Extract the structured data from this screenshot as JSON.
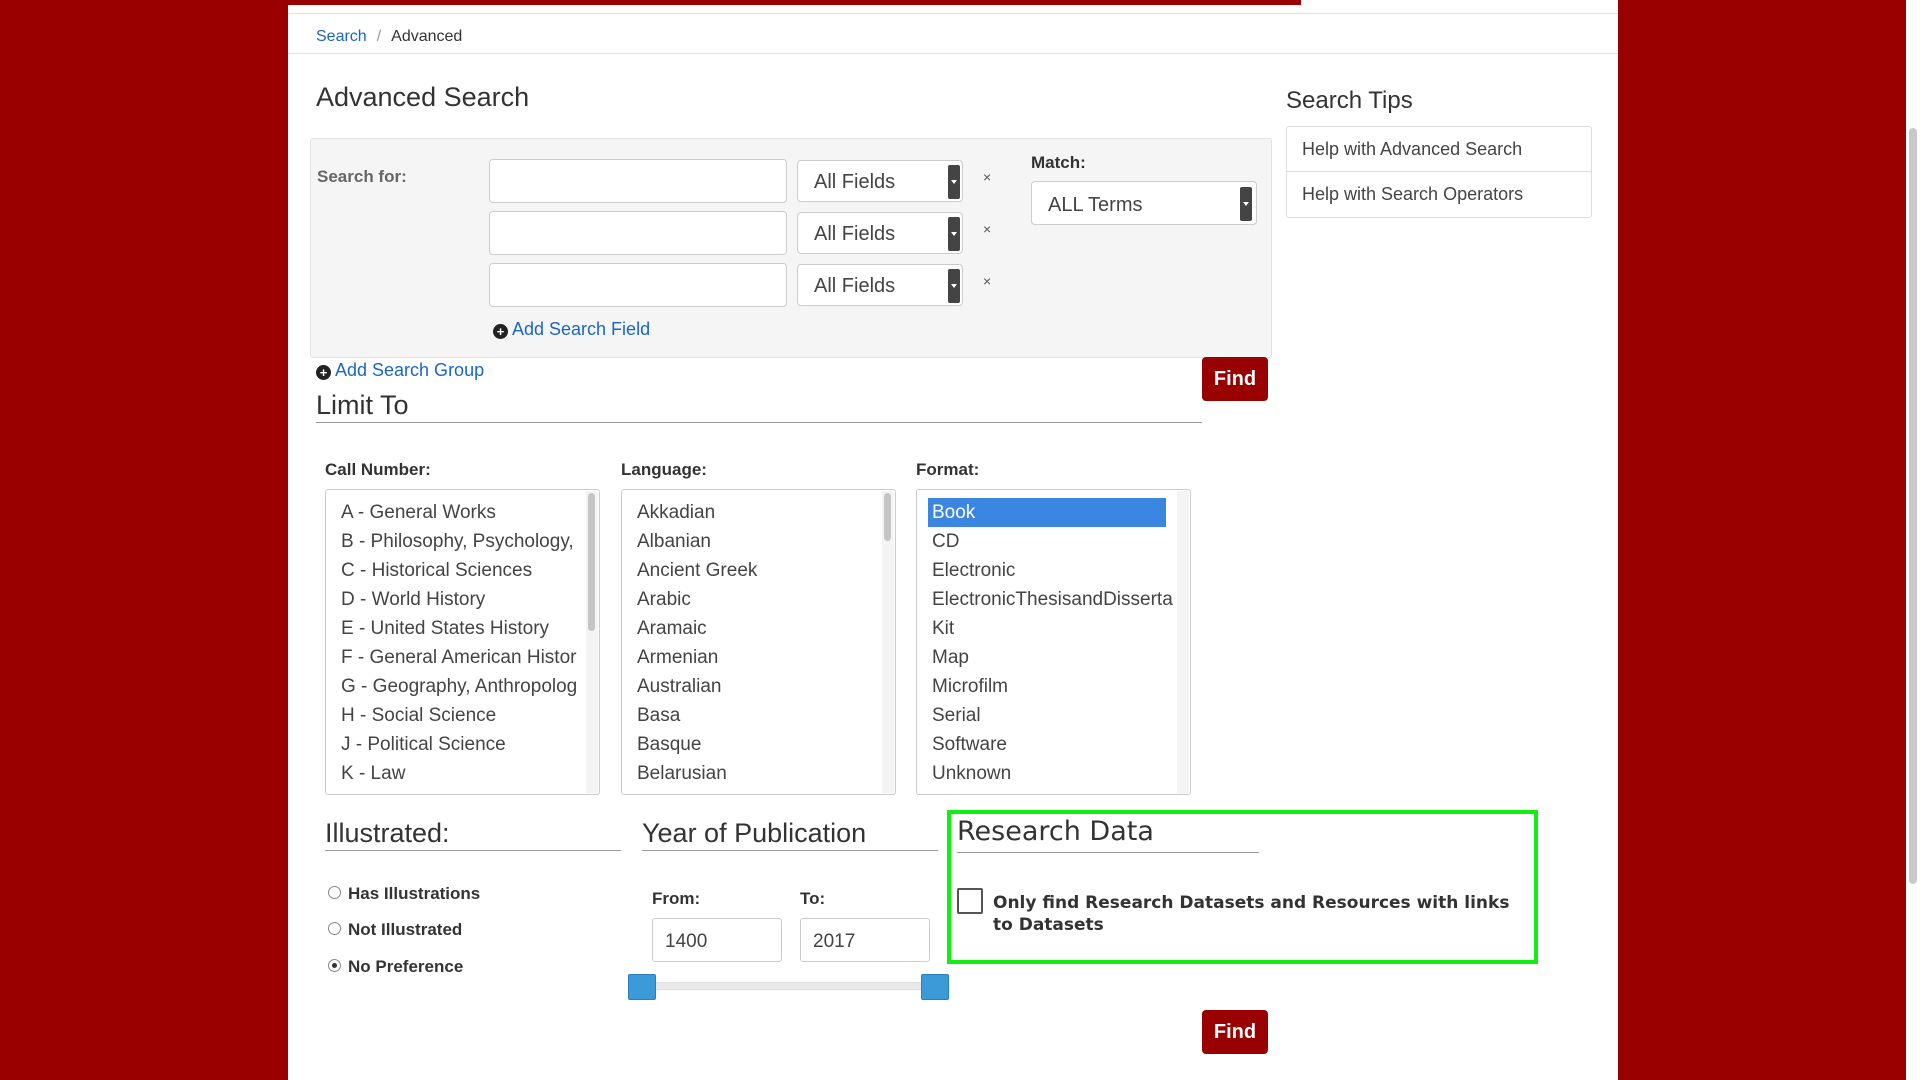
{
  "breadcrumb": {
    "search": "Search",
    "separator": "/",
    "current": "Advanced"
  },
  "page_title": "Advanced Search",
  "search_group": {
    "search_for_label": "Search for:",
    "rows": [
      {
        "value": "",
        "field": "All Fields",
        "remove": "×"
      },
      {
        "value": "",
        "field": "All Fields",
        "remove": "×"
      },
      {
        "value": "",
        "field": "All Fields",
        "remove": "×"
      }
    ],
    "match_label": "Match:",
    "match_value": "ALL Terms",
    "add_field": "Add Search Field"
  },
  "add_group": "Add Search Group",
  "find_label": "Find",
  "limit_to": "Limit To",
  "call_number": {
    "label": "Call Number:",
    "options": [
      "A - General Works",
      "B - Philosophy, Psychology,",
      "C - Historical Sciences",
      "D - World History",
      "E - United States History",
      "F - General American Histor",
      "G - Geography, Anthropolog",
      "H - Social Science",
      "J - Political Science",
      "K - Law"
    ]
  },
  "language": {
    "label": "Language:",
    "options": [
      "Akkadian",
      "Albanian",
      "Ancient Greek",
      "Arabic",
      "Aramaic",
      "Armenian",
      "Australian",
      "Basa",
      "Basque",
      "Belarusian"
    ]
  },
  "format": {
    "label": "Format:",
    "options": [
      "Book",
      "CD",
      "Electronic",
      "ElectronicThesisandDisserta",
      "Kit",
      "Map",
      "Microfilm",
      "Serial",
      "Software",
      "Unknown"
    ],
    "selected": "Book"
  },
  "illustrated": {
    "title": "Illustrated:",
    "options": [
      "Has Illustrations",
      "Not Illustrated",
      "No Preference"
    ],
    "selected": "No Preference"
  },
  "year": {
    "title": "Year of Publication",
    "from_label": "From:",
    "to_label": "To:",
    "from": "1400",
    "to": "2017"
  },
  "research": {
    "title": "Research Data",
    "checkbox_label": "Only find Research Datasets and Resources with links to Datasets",
    "checked": false
  },
  "tips": {
    "title": "Search Tips",
    "links": [
      "Help with Advanced Search",
      "Help with Search Operators"
    ]
  },
  "colors": {
    "brand": "#990000",
    "link": "#1a66c2",
    "selection": "#3b86e0",
    "highlight_box": "#11ee11"
  }
}
